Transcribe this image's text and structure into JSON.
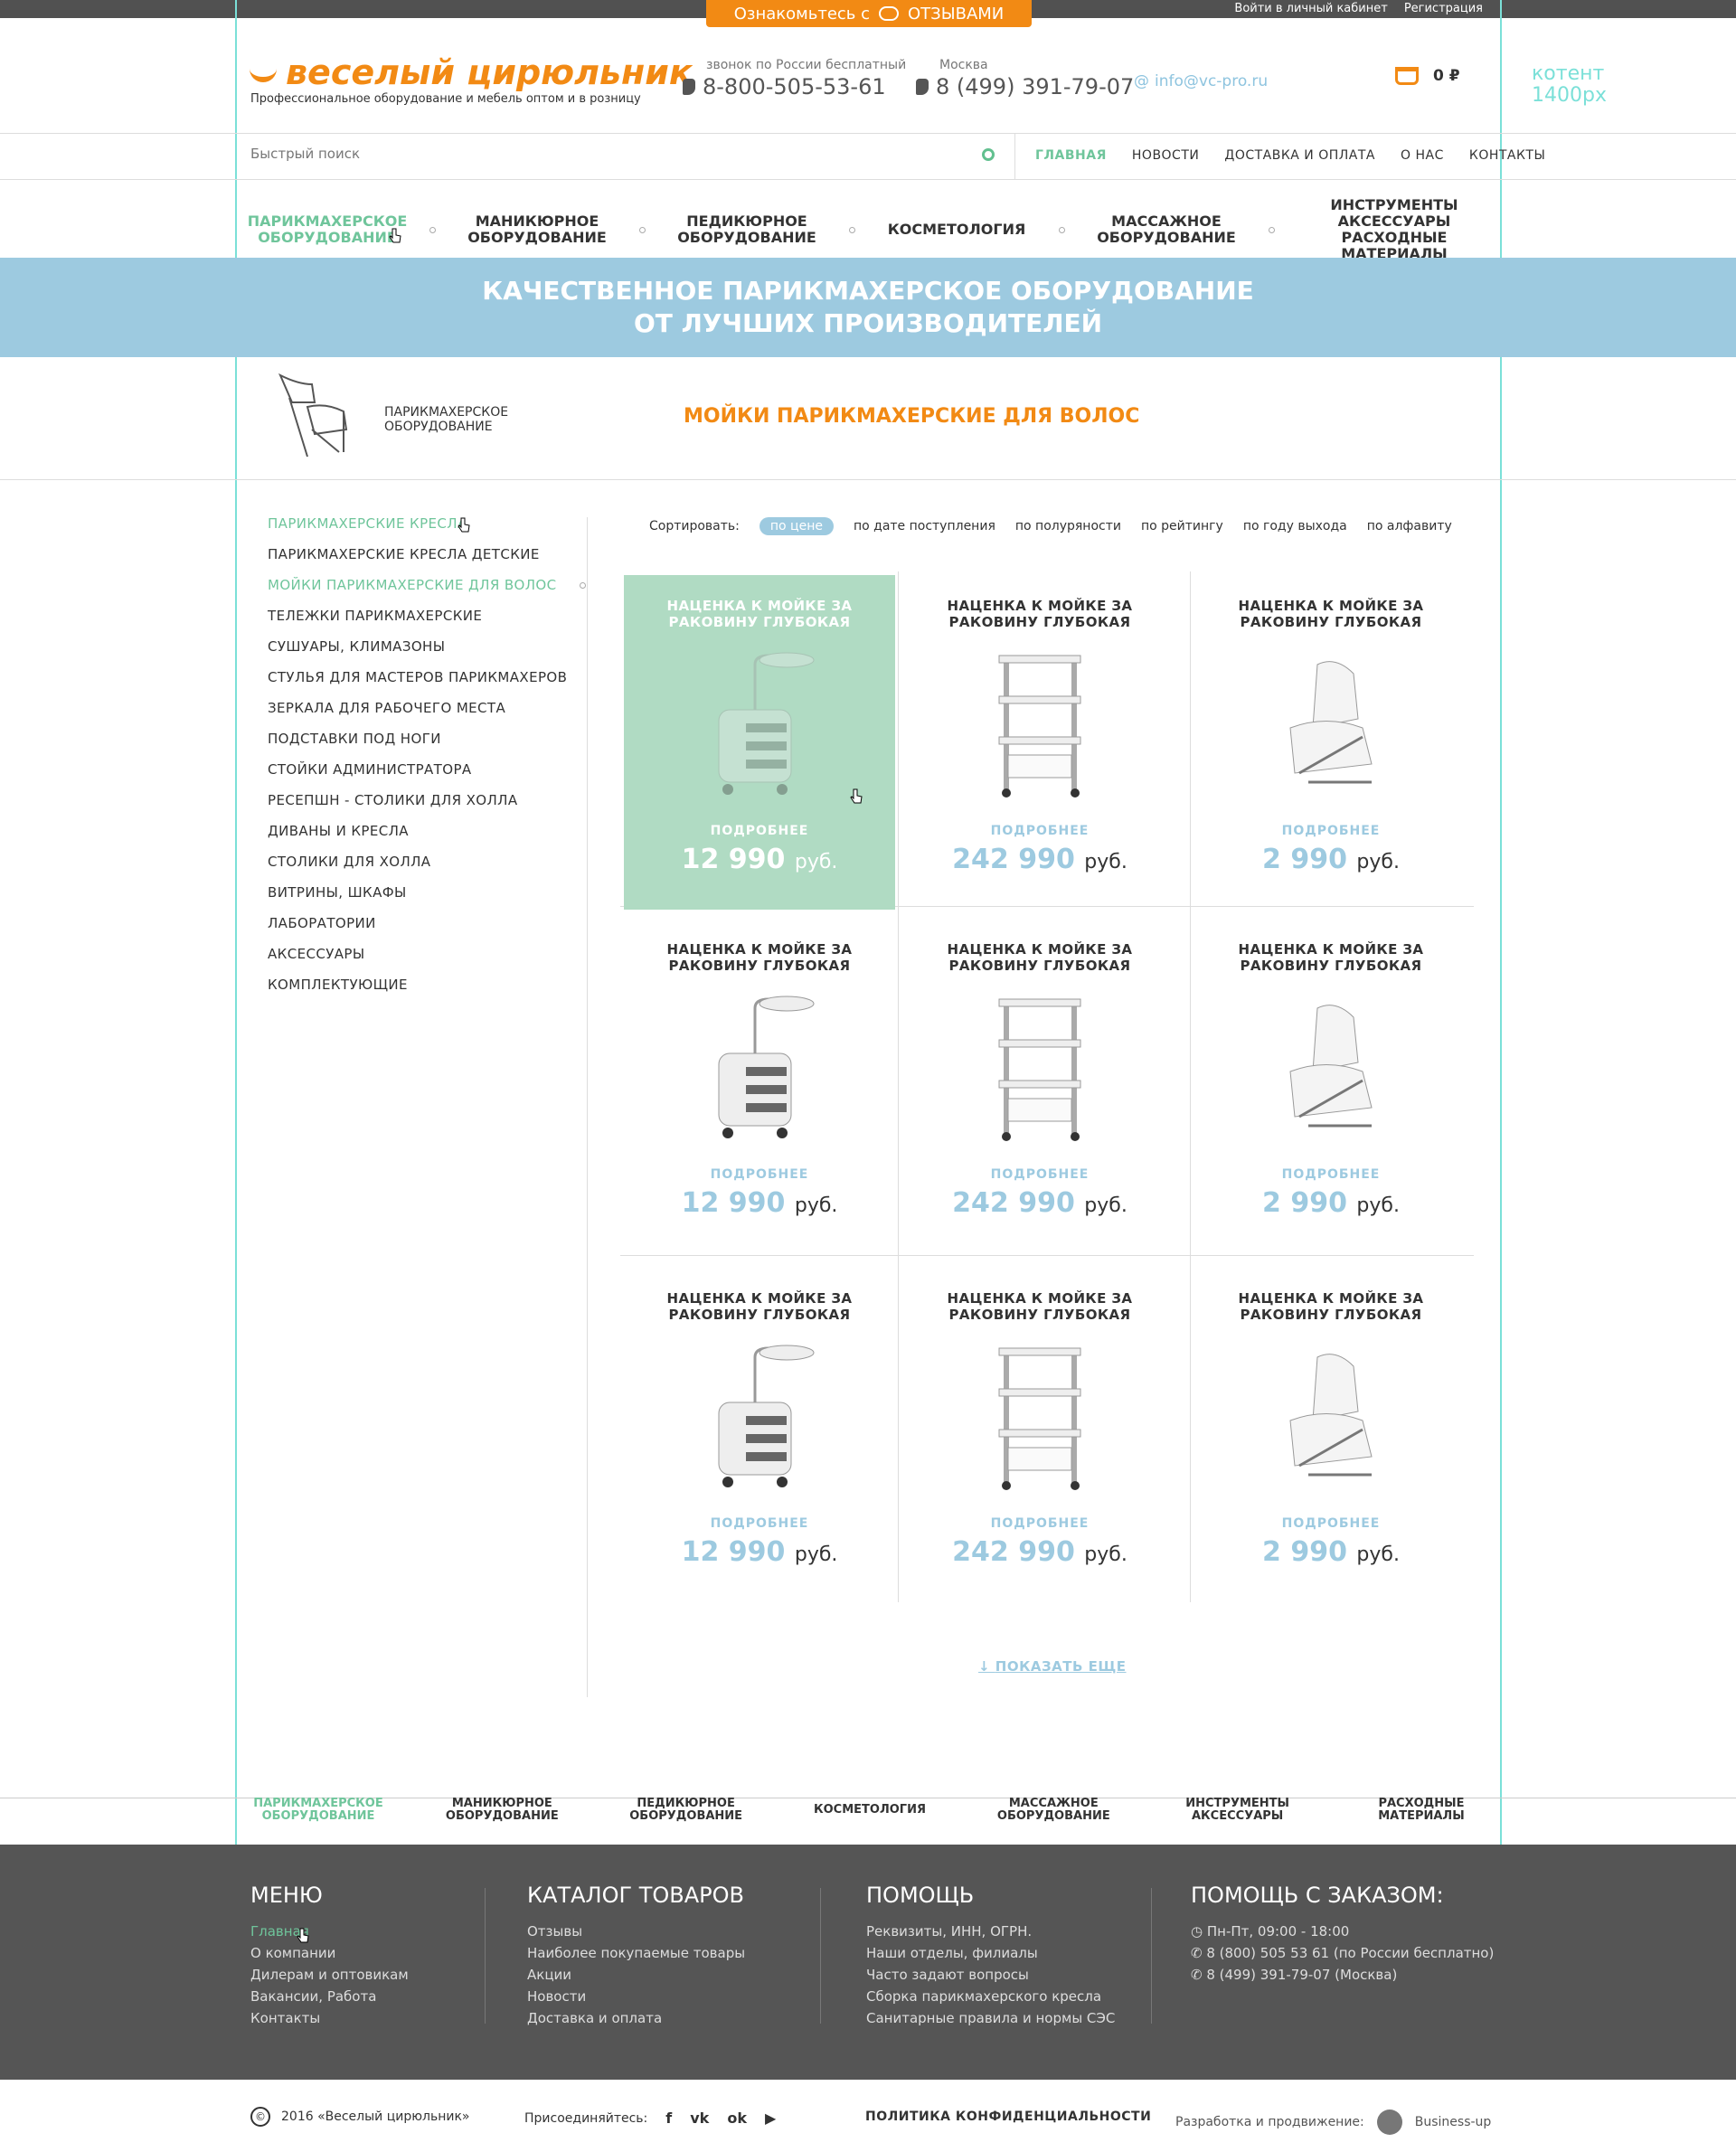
{
  "promo": {
    "text": "Ознакомьтесь с",
    "highlight": "ОТЗЫВАМИ"
  },
  "top_links": {
    "login": "Войти в личный кабинет",
    "register": "Регистрация"
  },
  "logo": {
    "name": "веселый цирюльник",
    "tagline": "Профессиональное оборудование и мебель оптом и в розницу"
  },
  "phones": [
    {
      "label": "звонок по России бесплатный",
      "number": "8-800-505-53-61"
    },
    {
      "label": "Москва",
      "number": "8 (499) 391-79-07"
    }
  ],
  "email": "info@vc-pro.ru",
  "basket": {
    "total": "0 ₽"
  },
  "layout_note": {
    "line1": "котент",
    "line2": "1400px"
  },
  "search": {
    "placeholder": "Быстрый поиск"
  },
  "nav_top": [
    "ГЛАВНАЯ",
    "НОВОСТИ",
    "ДОСТАВКА И ОПЛАТА",
    "О НАС",
    "КОНТАКТЫ"
  ],
  "categories": [
    {
      "l1": "ПАРИКМАХЕРСКОЕ",
      "l2": "ОБОРУДОВАНИЕ"
    },
    {
      "l1": "МАНИКЮРНОЕ",
      "l2": "ОБОРУДОВАНИЕ"
    },
    {
      "l1": "ПЕДИКЮРНОЕ",
      "l2": "ОБОРУДОВАНИЕ"
    },
    {
      "l1": "КОСМЕТОЛОГИЯ",
      "l2": ""
    },
    {
      "l1": "МАССАЖНОЕ",
      "l2": "ОБОРУДОВАНИЕ"
    },
    {
      "l1": "ИНСТРУМЕНТЫ АКСЕССУАРЫ",
      "l2": "РАСХОДНЫЕ МАТЕРИАЛЫ"
    }
  ],
  "banner": {
    "line1": "КАЧЕСТВЕННОЕ ПАРИКМАХЕРСКОЕ ОБОРУДОВАНИЕ",
    "line2": "ОТ ЛУЧШИХ ПРОИЗВОДИТЕЛЕЙ"
  },
  "breadcrumb": {
    "l1": "ПАРИКМАХЕРСКОЕ",
    "l2": "ОБОРУДОВАНИЕ"
  },
  "page_title": "МОЙКИ ПАРИКМАХЕРСКИЕ ДЛЯ ВОЛОС",
  "sidebar": [
    "ПАРИКМАХЕРСКИЕ КРЕСЛА",
    "ПАРИКМАХЕРСКИЕ КРЕСЛА ДЕТСКИЕ",
    "МОЙКИ ПАРИКМАХЕРСКИЕ ДЛЯ ВОЛОС",
    "ТЕЛЕЖКИ ПАРИКМАХЕРСКИЕ",
    "СУШУАРЫ, КЛИМАЗОНЫ",
    "СТУЛЬЯ ДЛЯ МАСТЕРОВ ПАРИКМАХЕРОВ",
    "ЗЕРКАЛА ДЛЯ РАБОЧЕГО МЕСТА",
    "ПОДСТАВКИ ПОД НОГИ",
    "СТОЙКИ АДМИНИСТРАТОРА",
    "РЕСЕПШН - СТОЛИКИ ДЛЯ ХОЛЛА",
    "ДИВАНЫ И КРЕСЛА",
    "СТОЛИКИ ДЛЯ ХОЛЛА",
    "ВИТРИНЫ, ШКАФЫ",
    "ЛАБОРАТОРИИ",
    "АКСЕССУАРЫ",
    "КОМПЛЕКТУЮЩИЕ"
  ],
  "sort": {
    "label": "Сортировать:",
    "options": [
      "по цене",
      "по дате поступления",
      "по полуряности",
      "по рейтингу",
      "по году выхода",
      "по алфавиту"
    ]
  },
  "products": [
    {
      "l1": "НАЦЕНКА К МОЙКЕ ЗА",
      "l2": "РАКОВИНУ ГЛУБОКАЯ",
      "more": "ПОДРОБНЕЕ",
      "price": "12 990",
      "cur": "руб."
    },
    {
      "l1": "НАЦЕНКА К МОЙКЕ ЗА",
      "l2": "РАКОВИНУ ГЛУБОКАЯ",
      "more": "ПОДРОБНЕЕ",
      "price": "242 990",
      "cur": "руб."
    },
    {
      "l1": "НАЦЕНКА К МОЙКЕ ЗА",
      "l2": "РАКОВИНУ ГЛУБОКАЯ",
      "more": "ПОДРОБНЕЕ",
      "price": "2 990",
      "cur": "руб."
    },
    {
      "l1": "НАЦЕНКА К МОЙКЕ ЗА",
      "l2": "РАКОВИНУ ГЛУБОКАЯ",
      "more": "ПОДРОБНЕЕ",
      "price": "12 990",
      "cur": "руб."
    },
    {
      "l1": "НАЦЕНКА К МОЙКЕ ЗА",
      "l2": "РАКОВИНУ ГЛУБОКАЯ",
      "more": "ПОДРОБНЕЕ",
      "price": "242 990",
      "cur": "руб."
    },
    {
      "l1": "НАЦЕНКА К МОЙКЕ ЗА",
      "l2": "РАКОВИНУ ГЛУБОКАЯ",
      "more": "ПОДРОБНЕЕ",
      "price": "2 990",
      "cur": "руб."
    },
    {
      "l1": "НАЦЕНКА К МОЙКЕ ЗА",
      "l2": "РАКОВИНУ ГЛУБОКАЯ",
      "more": "ПОДРОБНЕЕ",
      "price": "12 990",
      "cur": "руб."
    },
    {
      "l1": "НАЦЕНКА К МОЙКЕ ЗА",
      "l2": "РАКОВИНУ ГЛУБОКАЯ",
      "more": "ПОДРОБНЕЕ",
      "price": "242 990",
      "cur": "руб."
    },
    {
      "l1": "НАЦЕНКА К МОЙКЕ ЗА",
      "l2": "РАКОВИНУ ГЛУБОКАЯ",
      "more": "ПОДРОБНЕЕ",
      "price": "2 990",
      "cur": "руб."
    }
  ],
  "show_more": "ПОКАЗАТЬ ЕЩЕ",
  "footer_categories": [
    {
      "l1": "ПАРИКМАХЕРСКОЕ",
      "l2": "ОБОРУДОВАНИЕ"
    },
    {
      "l1": "МАНИКЮРНОЕ",
      "l2": "ОБОРУДОВАНИЕ"
    },
    {
      "l1": "ПЕДИКЮРНОЕ",
      "l2": "ОБОРУДОВАНИЕ"
    },
    {
      "l1": "КОСМЕТОЛОГИЯ",
      "l2": ""
    },
    {
      "l1": "МАССАЖНОЕ",
      "l2": "ОБОРУДОВАНИЕ"
    },
    {
      "l1": "ИНСТРУМЕНТЫ",
      "l2": "АКСЕССУАРЫ"
    },
    {
      "l1": "РАСХОДНЫЕ",
      "l2": "МАТЕРИАЛЫ"
    }
  ],
  "footer": {
    "menu": {
      "title": "МЕНЮ",
      "items": [
        "Главная",
        "О компании",
        "Дилерам и оптовикам",
        "Вакансии, Работа",
        "Контакты"
      ]
    },
    "catalog": {
      "title": "КАТАЛОГ ТОВАРОВ",
      "items": [
        "Отзывы",
        "Наиболее покупаемые товары",
        "Акции",
        "Новости",
        "Доставка и оплата"
      ]
    },
    "help": {
      "title": "ПОМОЩЬ",
      "items": [
        "Реквизиты, ИНН, ОГРН.",
        "Наши отделы, филиалы",
        "Часто задают вопросы",
        "Сборка парикмахерского кресла",
        "Санитарные правила и нормы СЭС"
      ]
    },
    "order": {
      "title": "ПОМОЩЬ С ЗАКАЗОМ:",
      "items": [
        "Пн-Пт, 09:00 - 18:00",
        "8 (800) 505 53 61 (по России бесплатно)",
        "8 (499) 391-79-07 (Москва)"
      ]
    }
  },
  "bottom": {
    "copyright": "2016 «Веселый цирюльник»",
    "join": "Присоединяйтесь:",
    "policy": "ПОЛИТИКА КОНФИДЕНЦИАЛЬНОСТИ",
    "dev_label": "Разработка и продвижение:",
    "dev_name": "Business-up"
  },
  "colors": {
    "accent": "#f28a14",
    "green": "#6fc59b",
    "blue": "#9dcae0",
    "footer": "#555555"
  }
}
